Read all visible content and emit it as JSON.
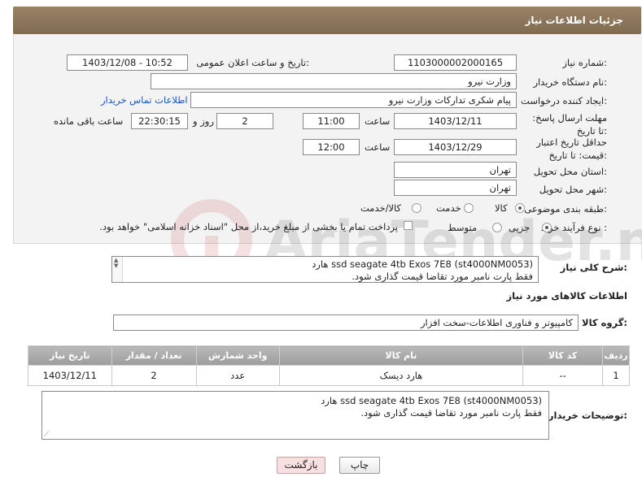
{
  "header": {
    "title": "جزئیات اطلاعات نیاز"
  },
  "form": {
    "need_number_label": "شماره نیاز:",
    "need_number": "1103000002000165",
    "announce_label": "تاریخ و ساعت اعلان عمومی:",
    "announce_value": "1403/12/08 - 10:52",
    "buyer_label": "نام دستگاه خریدار:",
    "buyer_value": "وزارت نیرو",
    "requester_label": "ایجاد کننده درخواست:",
    "requester_value": "پیام شکری تدارکات وزارت نیرو",
    "contact_link": "اطلاعات تماس خریدار",
    "deadline_label": "مهلت ارسال پاسخ: تا تاریخ:",
    "deadline_date": "1403/12/11",
    "time_label": "ساعت",
    "deadline_time": "11:00",
    "days_value": "2",
    "days_label": "روز و",
    "remaining_time": "22:30:15",
    "remaining_label": "ساعت باقی مانده",
    "validity_label": "حداقل تاریخ اعتبار قیمت: تا تاریخ:",
    "validity_date": "1403/12/29",
    "validity_time": "12:00",
    "province_label": "استان محل تحویل:",
    "province_value": "تهران",
    "city_label": "شهر محل تحویل:",
    "city_value": "تهران",
    "category_label": "طبقه بندی موضوعی:",
    "category_options": [
      "کالا",
      "خدمت",
      "کالا/خدمت"
    ],
    "category_selected": "کالا",
    "process_label": "نوع فرآیند خرید :",
    "process_options": [
      "جزیی",
      "متوسط"
    ],
    "process_selected": "جزیی",
    "payment_text": "پرداخت تمام یا بخشی از مبلغ خرید،از محل \"اسناد خزانه اسلامی\" خواهد بود."
  },
  "summary": {
    "label": "شرح کلی نیاز:",
    "line1": "هارد ssd seagate 4tb Exos 7E8 (st4000NM0053)",
    "line2": "فقط پارت نامبر مورد تقاضا قیمت گذاری شود."
  },
  "goods": {
    "section_title": "اطلاعات کالاهای مورد نیاز",
    "group_label": "گروه کالا:",
    "group_value": "کامپیوتر و فناوری اطلاعات-سخت افزار",
    "columns": [
      "ردیف",
      "کد کالا",
      "نام کالا",
      "واحد شمارش",
      "تعداد / مقدار",
      "تاریخ نیاز"
    ],
    "rows": [
      [
        "1",
        "--",
        "هارد دیسک",
        "عدد",
        "2",
        "1403/12/11"
      ]
    ]
  },
  "buyer_notes": {
    "label": "توضیحات خریدار:",
    "line1": "هارد ssd seagate 4tb Exos 7E8 (st4000NM0053)",
    "line2": "فقط پارت نامبر مورد تقاضا قیمت گذاری شود."
  },
  "buttons": {
    "print": "چاپ",
    "back": "بازگشت"
  },
  "watermark": {
    "text": "AriaTender.net"
  },
  "colors": {
    "header": "#8b7459",
    "link": "#1a56c4",
    "back_button": "#f8e0e0"
  }
}
